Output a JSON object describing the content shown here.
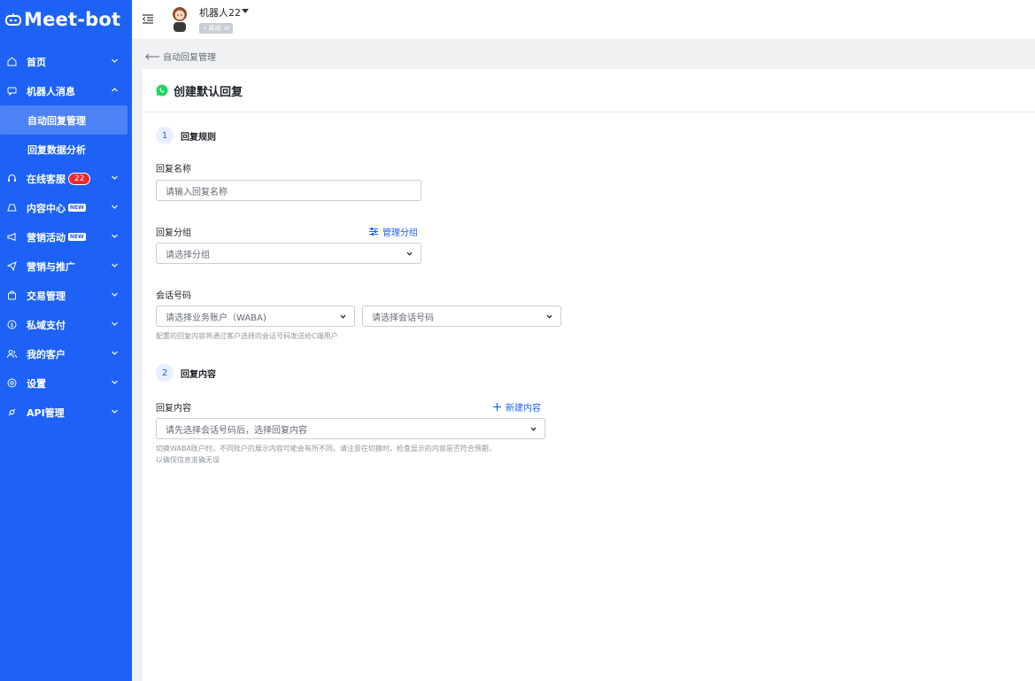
{
  "brand": {
    "name": "Meet-bot"
  },
  "sidebar": {
    "items": [
      {
        "label": "首页",
        "icon": "home-icon",
        "expanded": false
      },
      {
        "label": "机器人消息",
        "icon": "chat-bot-icon",
        "expanded": true,
        "children": [
          {
            "label": "自动回复管理",
            "active": true
          },
          {
            "label": "回复数据分析",
            "active": false
          }
        ]
      },
      {
        "label": "在线客服",
        "icon": "headset-icon",
        "badge": "22",
        "expanded": false
      },
      {
        "label": "内容中心",
        "icon": "content-icon",
        "tag": "NEW",
        "expanded": false
      },
      {
        "label": "营销活动",
        "icon": "megaphone-icon",
        "tag": "NEW",
        "expanded": false
      },
      {
        "label": "营销与推广",
        "icon": "send-icon",
        "expanded": false
      },
      {
        "label": "交易管理",
        "icon": "bag-icon",
        "expanded": false
      },
      {
        "label": "私域支付",
        "icon": "coin-icon",
        "expanded": false
      },
      {
        "label": "我的客户",
        "icon": "users-icon",
        "expanded": false
      },
      {
        "label": "设置",
        "icon": "gear-icon",
        "expanded": false
      },
      {
        "label": "API管理",
        "icon": "api-icon",
        "expanded": false
      }
    ]
  },
  "header": {
    "user_name": "机器人22",
    "status": "• 离线",
    "status_switch": "⇄"
  },
  "breadcrumb": {
    "back_label": "自动回复管理"
  },
  "page": {
    "title": "创建默认回复",
    "step1": {
      "num": "1",
      "title": "回复规则"
    },
    "reply_name": {
      "label": "回复名称",
      "placeholder": "请输入回复名称"
    },
    "reply_group": {
      "label": "回复分组",
      "manage_link": "管理分组",
      "placeholder": "请选择分组"
    },
    "session_number": {
      "label": "会话号码",
      "waba_placeholder": "请选择业务账户（WABA)",
      "number_placeholder": "请选择会话号码",
      "hint": "配置的回复内容将通过客户选择的会话号码发送给C端用户"
    },
    "step2": {
      "num": "2",
      "title": "回复内容"
    },
    "reply_content": {
      "label": "回复内容",
      "new_link": "新建内容",
      "placeholder": "请先选择会话号码后，选择回复内容",
      "hint_line1": "切换WABA账户时，不同账户的展示内容可能会有所不同。请注意在切换时，检查显示的内容是否符合预期，",
      "hint_line2": "以确保信息准确无误"
    }
  },
  "colors": {
    "primary": "#1d62f5",
    "badge": "#f0282d",
    "whatsapp": "#25d366"
  }
}
